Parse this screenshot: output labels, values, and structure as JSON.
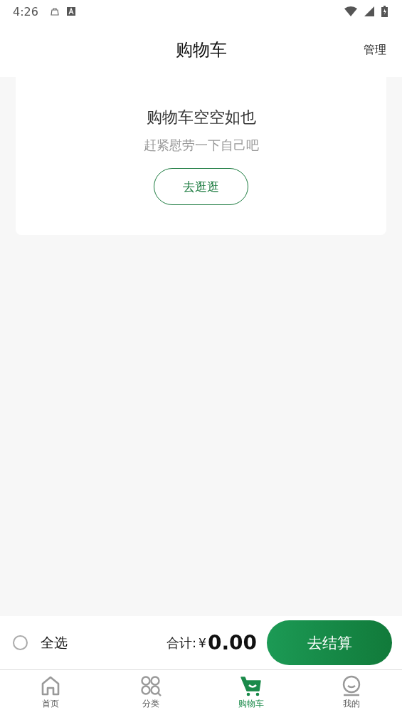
{
  "status_bar": {
    "time": "4:26"
  },
  "header": {
    "title": "购物车",
    "action": "管理"
  },
  "empty_state": {
    "title": "购物车空空如也",
    "subtitle": "赶紧慰劳一下自己吧",
    "button": "去逛逛"
  },
  "footer": {
    "select_all": {
      "label": "全选",
      "checked": false
    },
    "total_label": "合计:",
    "currency": "¥",
    "total": "0.00",
    "checkout": "去结算"
  },
  "tabs": [
    {
      "kind": "home",
      "label": "首页",
      "selected": false
    },
    {
      "kind": "category",
      "label": "分类",
      "selected": false
    },
    {
      "kind": "cart",
      "label": "购物车",
      "selected": true
    },
    {
      "kind": "profile",
      "label": "我的",
      "selected": false
    }
  ]
}
